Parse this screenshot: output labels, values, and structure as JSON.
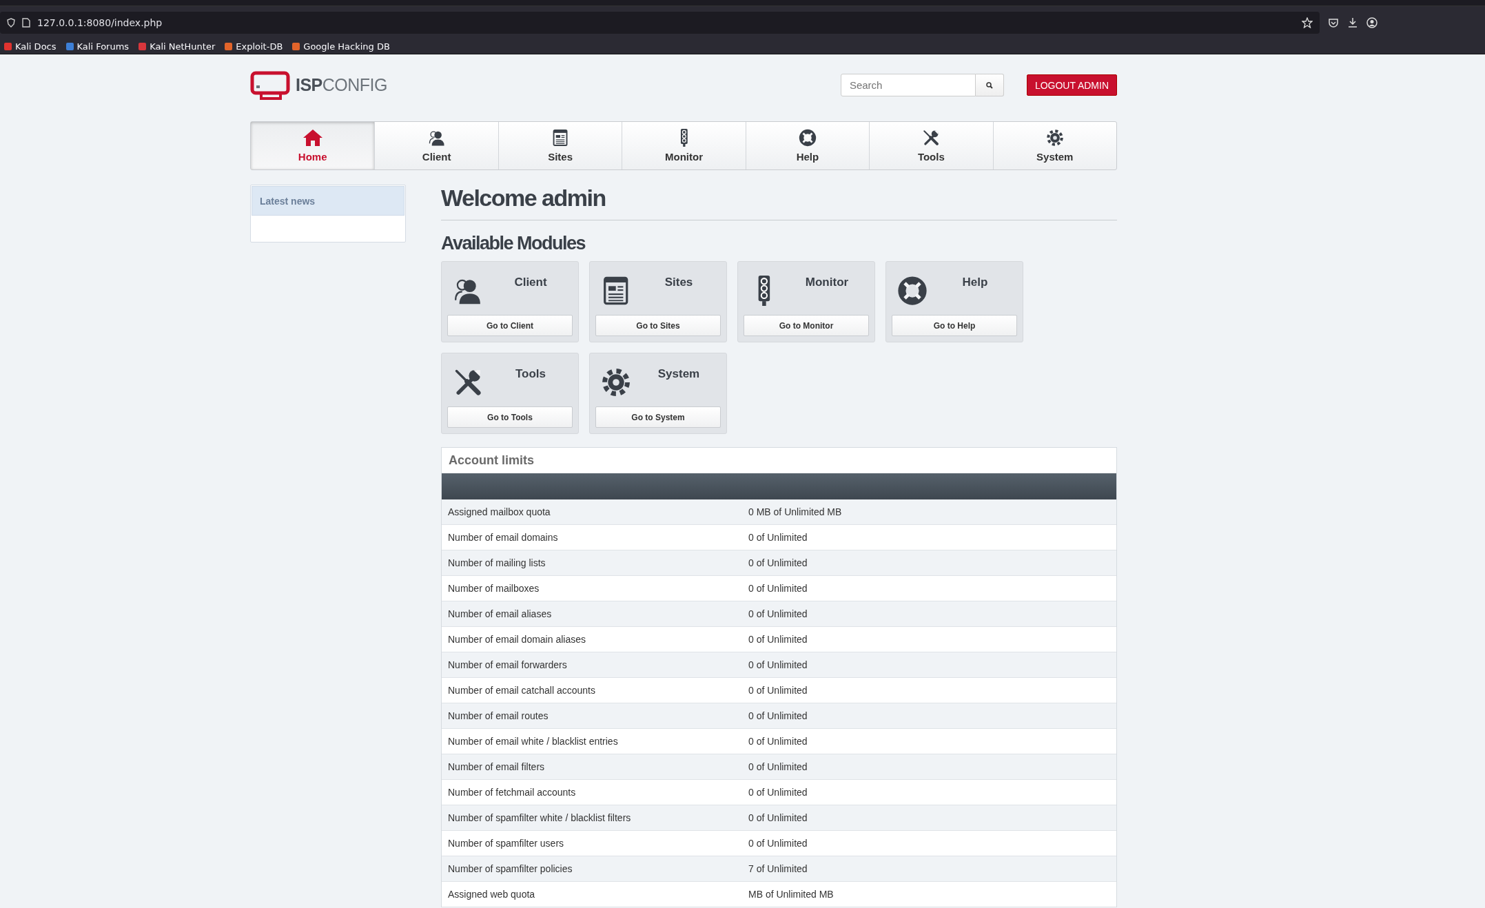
{
  "browser": {
    "url": "127.0.0.1:8080/index.php",
    "bookmarks": [
      {
        "label": "Kali Docs",
        "color": "#e0332f"
      },
      {
        "label": "Kali Forums",
        "color": "#3d7fd6"
      },
      {
        "label": "Kali NetHunter",
        "color": "#d8363c"
      },
      {
        "label": "Exploit-DB",
        "color": "#e2642a"
      },
      {
        "label": "Google Hacking DB",
        "color": "#e2642a"
      }
    ]
  },
  "header": {
    "logo": "**ISP**CONFIG",
    "search": {
      "placeholder": "Search"
    },
    "logout": "LOGOUT ADMIN"
  },
  "nav": [
    {
      "label": "Home",
      "kind": "home",
      "selected": true
    },
    {
      "label": "Client",
      "kind": "client",
      "selected": false
    },
    {
      "label": "Sites",
      "kind": "sites",
      "selected": false
    },
    {
      "label": "Monitor",
      "kind": "monitor",
      "selected": false
    },
    {
      "label": "Help",
      "kind": "help",
      "selected": false
    },
    {
      "label": "Tools",
      "kind": "tools",
      "selected": false
    },
    {
      "label": "System",
      "kind": "system",
      "selected": false
    }
  ],
  "sidebar": {
    "title": "Latest news"
  },
  "welcome": "Welcome admin",
  "modules_title": "Available Modules",
  "modules": [
    {
      "title": "Client",
      "kind": "client",
      "button": "Go to Client"
    },
    {
      "title": "Sites",
      "kind": "sites",
      "button": "Go to Sites"
    },
    {
      "title": "Monitor",
      "kind": "monitor",
      "button": "Go to Monitor"
    },
    {
      "title": "Help",
      "kind": "help",
      "button": "Go to Help"
    },
    {
      "title": "Tools",
      "kind": "tools",
      "button": "Go to Tools"
    },
    {
      "title": "System",
      "kind": "system",
      "button": "Go to System"
    }
  ],
  "account_limits": {
    "title": "Account limits",
    "rows": [
      {
        "label": "Assigned mailbox quota",
        "value": "0 MB of Unlimited MB"
      },
      {
        "label": "Number of email domains",
        "value": "0 of Unlimited"
      },
      {
        "label": "Number of mailing lists",
        "value": "0 of Unlimited"
      },
      {
        "label": "Number of mailboxes",
        "value": "0 of Unlimited"
      },
      {
        "label": "Number of email aliases",
        "value": "0 of Unlimited"
      },
      {
        "label": "Number of email domain aliases",
        "value": "0 of Unlimited"
      },
      {
        "label": "Number of email forwarders",
        "value": "0 of Unlimited"
      },
      {
        "label": "Number of email catchall accounts",
        "value": "0 of Unlimited"
      },
      {
        "label": "Number of email routes",
        "value": "0 of Unlimited"
      },
      {
        "label": "Number of email white / blacklist entries",
        "value": "0 of Unlimited"
      },
      {
        "label": "Number of email filters",
        "value": "0 of Unlimited"
      },
      {
        "label": "Number of fetchmail accounts",
        "value": "0 of Unlimited"
      },
      {
        "label": "Number of spamfilter white / blacklist filters",
        "value": "0 of Unlimited"
      },
      {
        "label": "Number of spamfilter users",
        "value": "0 of Unlimited"
      },
      {
        "label": "Number of spamfilter policies",
        "value": "7 of Unlimited"
      },
      {
        "label": "Assigned web quota",
        "value": "MB of Unlimited MB"
      }
    ]
  }
}
